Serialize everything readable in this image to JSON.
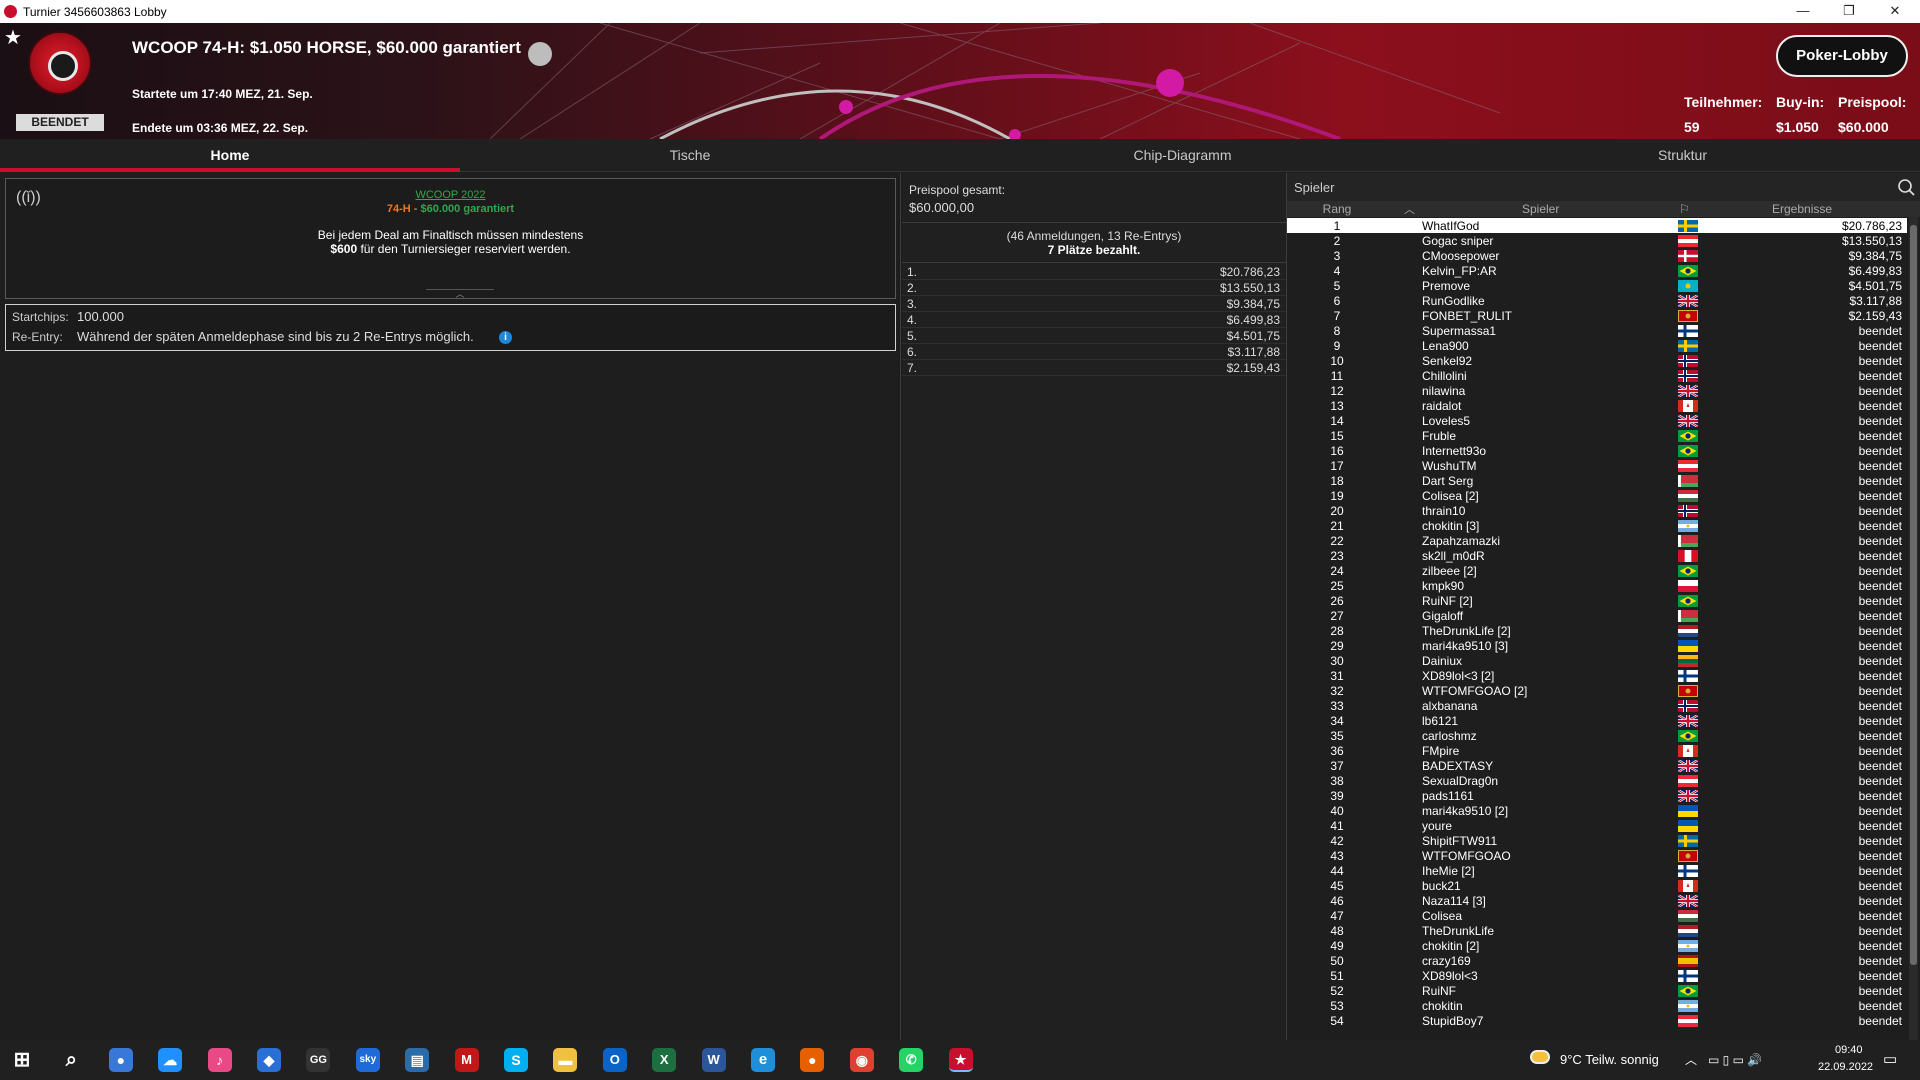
{
  "window": {
    "title": "Turnier 3456603863 Lobby",
    "controls": [
      "—",
      "❐",
      "✕"
    ]
  },
  "header": {
    "tournament_name": "WCOOP 74-H: $1.050 HORSE, $60.000 garantiert",
    "status_badge": "BEENDET",
    "started": "Startete um 17:40 MEZ, 21. Sep.",
    "ended": "Endete um 03:36 MEZ, 22. Sep.",
    "lobby_button": "Poker-Lobby",
    "stats": [
      {
        "label": "Teilnehmer:",
        "value": "59"
      },
      {
        "label": "Buy-in:",
        "value": "$1.050"
      },
      {
        "label": "Preispool:",
        "value": "$60.000"
      }
    ]
  },
  "tabs": [
    {
      "label": "Home",
      "active": true
    },
    {
      "label": "Tische",
      "active": false
    },
    {
      "label": "Chip-Diagramm",
      "active": false
    },
    {
      "label": "Struktur",
      "active": false
    }
  ],
  "home": {
    "series_link": "WCOOP 2022",
    "series_event": "74-H",
    "series_dash": " - ",
    "series_guarantee": "$60.000 garantiert",
    "deal_line1": "Bei jedem Deal am Finaltisch müssen mindestens",
    "deal_amount": "$600",
    "deal_line2": "für den Turniersieger reserviert werden.",
    "startchips_label": "Startchips:",
    "startchips_value": "100.000",
    "reentry_label": "Re-Entry:",
    "reentry_value": "Während der späten Anmeldephase sind bis zu 2 Re-Entrys möglich."
  },
  "prizepool": {
    "label": "Preispool gesamt:",
    "total": "$60.000,00",
    "entries": "(46 Anmeldungen, 13 Re-Entrys)",
    "paid": "7 Plätze bezahlt.",
    "prizes": [
      {
        "place": "1.",
        "amount": "$20.786,23"
      },
      {
        "place": "2.",
        "amount": "$13.550,13"
      },
      {
        "place": "3.",
        "amount": "$9.384,75"
      },
      {
        "place": "4.",
        "amount": "$6.499,83"
      },
      {
        "place": "5.",
        "amount": "$4.501,75"
      },
      {
        "place": "6.",
        "amount": "$3.117,88"
      },
      {
        "place": "7.",
        "amount": "$2.159,43"
      }
    ]
  },
  "players": {
    "search_label": "Spieler",
    "columns": {
      "rank": "Rang",
      "player": "Spieler",
      "result": "Ergebnisse"
    },
    "rows": [
      {
        "rank": "1",
        "name": "WhatIfGod",
        "flag": "se",
        "result": "$20.786,23"
      },
      {
        "rank": "2",
        "name": "Gogac sniper",
        "flag": "at",
        "result": "$13.550,13"
      },
      {
        "rank": "3",
        "name": "CMoosepower",
        "flag": "dk",
        "result": "$9.384,75"
      },
      {
        "rank": "4",
        "name": "Kelvin_FP:AR",
        "flag": "br",
        "result": "$6.499,83"
      },
      {
        "rank": "5",
        "name": "Premove",
        "flag": "kz",
        "result": "$4.501,75"
      },
      {
        "rank": "6",
        "name": "RunGodlike",
        "flag": "gb",
        "result": "$3.117,88"
      },
      {
        "rank": "7",
        "name": "FONBET_RULIT",
        "flag": "me",
        "result": "$2.159,43"
      },
      {
        "rank": "8",
        "name": "Supermassa1",
        "flag": "fi",
        "result": "beendet"
      },
      {
        "rank": "9",
        "name": "Lena900",
        "flag": "se",
        "result": "beendet"
      },
      {
        "rank": "10",
        "name": "Senkel92",
        "flag": "no",
        "result": "beendet"
      },
      {
        "rank": "11",
        "name": "Chillolini",
        "flag": "no",
        "result": "beendet"
      },
      {
        "rank": "12",
        "name": "nilawina",
        "flag": "gb",
        "result": "beendet"
      },
      {
        "rank": "13",
        "name": "raidalot",
        "flag": "ca",
        "result": "beendet"
      },
      {
        "rank": "14",
        "name": "Loveles5",
        "flag": "gb",
        "result": "beendet"
      },
      {
        "rank": "15",
        "name": "Fruble",
        "flag": "br",
        "result": "beendet"
      },
      {
        "rank": "16",
        "name": "Internett93o",
        "flag": "br",
        "result": "beendet"
      },
      {
        "rank": "17",
        "name": "WushuTM",
        "flag": "at",
        "result": "beendet"
      },
      {
        "rank": "18",
        "name": "Dart Serg",
        "flag": "by",
        "result": "beendet"
      },
      {
        "rank": "19",
        "name": "Colisea [2]",
        "flag": "hu",
        "result": "beendet"
      },
      {
        "rank": "20",
        "name": "thrain10",
        "flag": "no",
        "result": "beendet"
      },
      {
        "rank": "21",
        "name": "chokitin [3]",
        "flag": "ar",
        "result": "beendet"
      },
      {
        "rank": "22",
        "name": "Zapahzamazki",
        "flag": "by",
        "result": "beendet"
      },
      {
        "rank": "23",
        "name": "sk2ll_m0dR",
        "flag": "pe",
        "result": "beendet"
      },
      {
        "rank": "24",
        "name": "zilbeee [2]",
        "flag": "br",
        "result": "beendet"
      },
      {
        "rank": "25",
        "name": "kmpk90",
        "flag": "pl",
        "result": "beendet"
      },
      {
        "rank": "26",
        "name": "RuiNF [2]",
        "flag": "br",
        "result": "beendet"
      },
      {
        "rank": "27",
        "name": "Gigaloff",
        "flag": "by",
        "result": "beendet"
      },
      {
        "rank": "28",
        "name": "TheDrunkLife [2]",
        "flag": "nl",
        "result": "beendet"
      },
      {
        "rank": "29",
        "name": "mari4ka9510 [3]",
        "flag": "ua",
        "result": "beendet"
      },
      {
        "rank": "30",
        "name": "Dainiux",
        "flag": "lt",
        "result": "beendet"
      },
      {
        "rank": "31",
        "name": "XD89lol<3 [2]",
        "flag": "fi",
        "result": "beendet"
      },
      {
        "rank": "32",
        "name": "WTFOMFGOAO [2]",
        "flag": "me",
        "result": "beendet"
      },
      {
        "rank": "33",
        "name": "alxbanana",
        "flag": "no",
        "result": "beendet"
      },
      {
        "rank": "34",
        "name": "lb6121",
        "flag": "gb",
        "result": "beendet"
      },
      {
        "rank": "35",
        "name": "carloshmz",
        "flag": "br",
        "result": "beendet"
      },
      {
        "rank": "36",
        "name": "FMpire",
        "flag": "ca",
        "result": "beendet"
      },
      {
        "rank": "37",
        "name": "BADEXTASY",
        "flag": "gb",
        "result": "beendet"
      },
      {
        "rank": "38",
        "name": "SexualDrag0n",
        "flag": "at",
        "result": "beendet"
      },
      {
        "rank": "39",
        "name": "pads1161",
        "flag": "gb",
        "result": "beendet"
      },
      {
        "rank": "40",
        "name": "mari4ka9510 [2]",
        "flag": "ua",
        "result": "beendet"
      },
      {
        "rank": "41",
        "name": "youre",
        "flag": "ua",
        "result": "beendet"
      },
      {
        "rank": "42",
        "name": "ShipitFTW911",
        "flag": "se",
        "result": "beendet"
      },
      {
        "rank": "43",
        "name": "WTFOMFGOAO",
        "flag": "me",
        "result": "beendet"
      },
      {
        "rank": "44",
        "name": "IheMie [2]",
        "flag": "fi",
        "result": "beendet"
      },
      {
        "rank": "45",
        "name": "buck21",
        "flag": "ca",
        "result": "beendet"
      },
      {
        "rank": "46",
        "name": "Naza114 [3]",
        "flag": "gb",
        "result": "beendet"
      },
      {
        "rank": "47",
        "name": "Colisea",
        "flag": "hu",
        "result": "beendet"
      },
      {
        "rank": "48",
        "name": "TheDrunkLife",
        "flag": "nl",
        "result": "beendet"
      },
      {
        "rank": "49",
        "name": "chokitin [2]",
        "flag": "ar",
        "result": "beendet"
      },
      {
        "rank": "50",
        "name": "crazy169",
        "flag": "es",
        "result": "beendet"
      },
      {
        "rank": "51",
        "name": "XD89lol<3",
        "flag": "fi",
        "result": "beendet"
      },
      {
        "rank": "52",
        "name": "RuiNF",
        "flag": "br",
        "result": "beendet"
      },
      {
        "rank": "53",
        "name": "chokitin",
        "flag": "ar",
        "result": "beendet"
      },
      {
        "rank": "54",
        "name": "StupidBoy7",
        "flag": "at",
        "result": "beendet"
      }
    ]
  },
  "taskbar": {
    "weather": "9°C  Teilw. sonnig",
    "time": "09:40",
    "date": "22.09.2022",
    "icons": [
      "windows-start-icon",
      "search-icon",
      "cortana-icon",
      "onedrive-icon",
      "itunes-icon",
      "app-icon",
      "gg-icon",
      "sky-icon",
      "video-icon",
      "mcafee-icon",
      "skype-icon",
      "file-explorer-icon",
      "outlook-icon",
      "excel-icon",
      "word-icon",
      "edge-icon",
      "firefox-icon",
      "chrome-icon",
      "whatsapp-icon",
      "pokerstars-icon"
    ]
  },
  "colors": {
    "accent": "#c8102e",
    "link_green": "#2ea84a",
    "event_orange": "#f07820"
  }
}
